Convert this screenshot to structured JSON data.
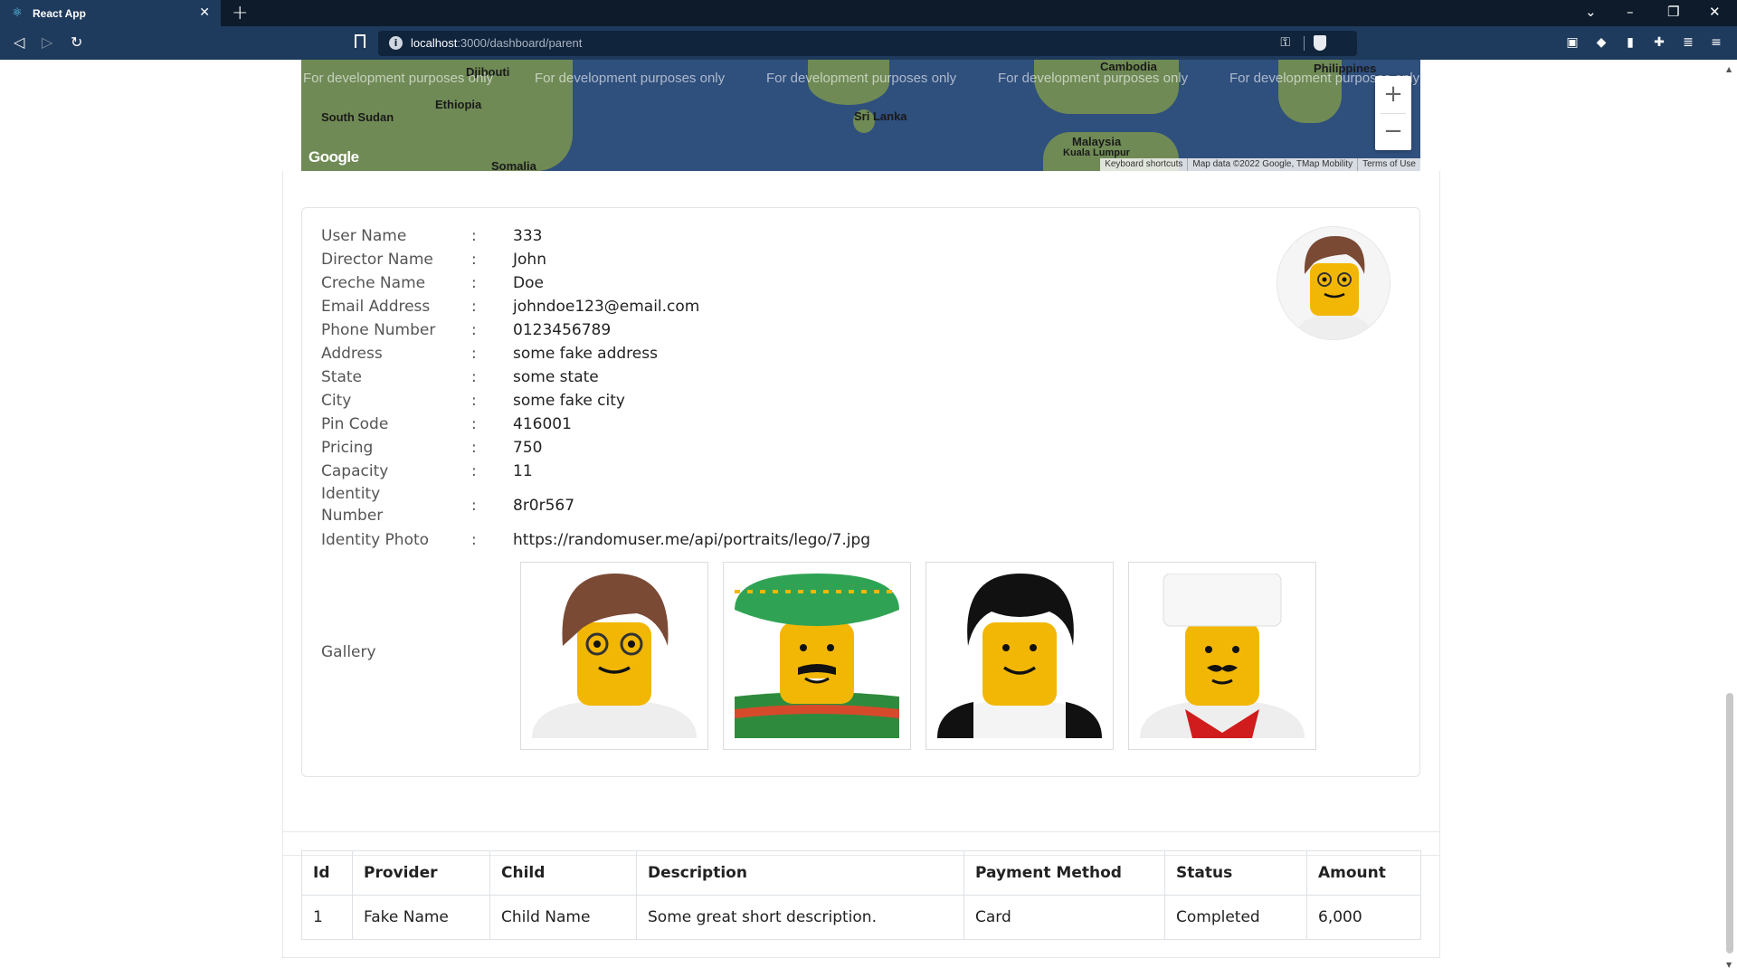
{
  "browser": {
    "tab_title": "React App",
    "tab_close": "✕",
    "new_tab": "+",
    "url_host": "localhost",
    "url_path": ":3000/dashboard/parent"
  },
  "map": {
    "dev_watermark": "For development purposes only",
    "places": [
      "Djibouti",
      "Ethiopia",
      "South Sudan",
      "Somalia",
      "Sri Lanka",
      "Cambodia",
      "Philippines",
      "Malaysia",
      "Kuala Lumpur"
    ],
    "zoom_in": "+",
    "zoom_out": "−",
    "logo": "Google",
    "attrib_shortcuts": "Keyboard shortcuts",
    "attrib_data": "Map data ©2022 Google, TMap Mobility",
    "attrib_terms": "Terms of Use"
  },
  "profile": {
    "fields": [
      {
        "label": "User Name",
        "value": "333"
      },
      {
        "label": "Director Name",
        "value": "John"
      },
      {
        "label": "Creche Name",
        "value": "Doe"
      },
      {
        "label": "Email Address",
        "value": "johndoe123@email.com"
      },
      {
        "label": "Phone Number",
        "value": "0123456789"
      },
      {
        "label": "Address",
        "value": "some fake address"
      },
      {
        "label": "State",
        "value": "some state"
      },
      {
        "label": "City",
        "value": "some fake city"
      },
      {
        "label": "Pin Code",
        "value": "416001"
      },
      {
        "label": "Pricing",
        "value": "750"
      },
      {
        "label": "Capacity",
        "value": "11"
      },
      {
        "label": "Identity Number",
        "value": "8r0r567"
      },
      {
        "label": "Identity Photo",
        "value": "https://randomuser.me/api/portraits/lego/7.jpg"
      }
    ],
    "colon": ":",
    "gallery_label": "Gallery"
  },
  "transactions": {
    "headers": [
      "Id",
      "Provider",
      "Child",
      "Description",
      "Payment Method",
      "Status",
      "Amount"
    ],
    "rows": [
      [
        "1",
        "Fake Name",
        "Child Name",
        "Some great short description.",
        "Card",
        "Completed",
        "6,000"
      ]
    ]
  },
  "colors": {
    "chrome_dark": "#0d1b2a",
    "chrome": "#1e3a5c",
    "border": "#dee2e6"
  }
}
